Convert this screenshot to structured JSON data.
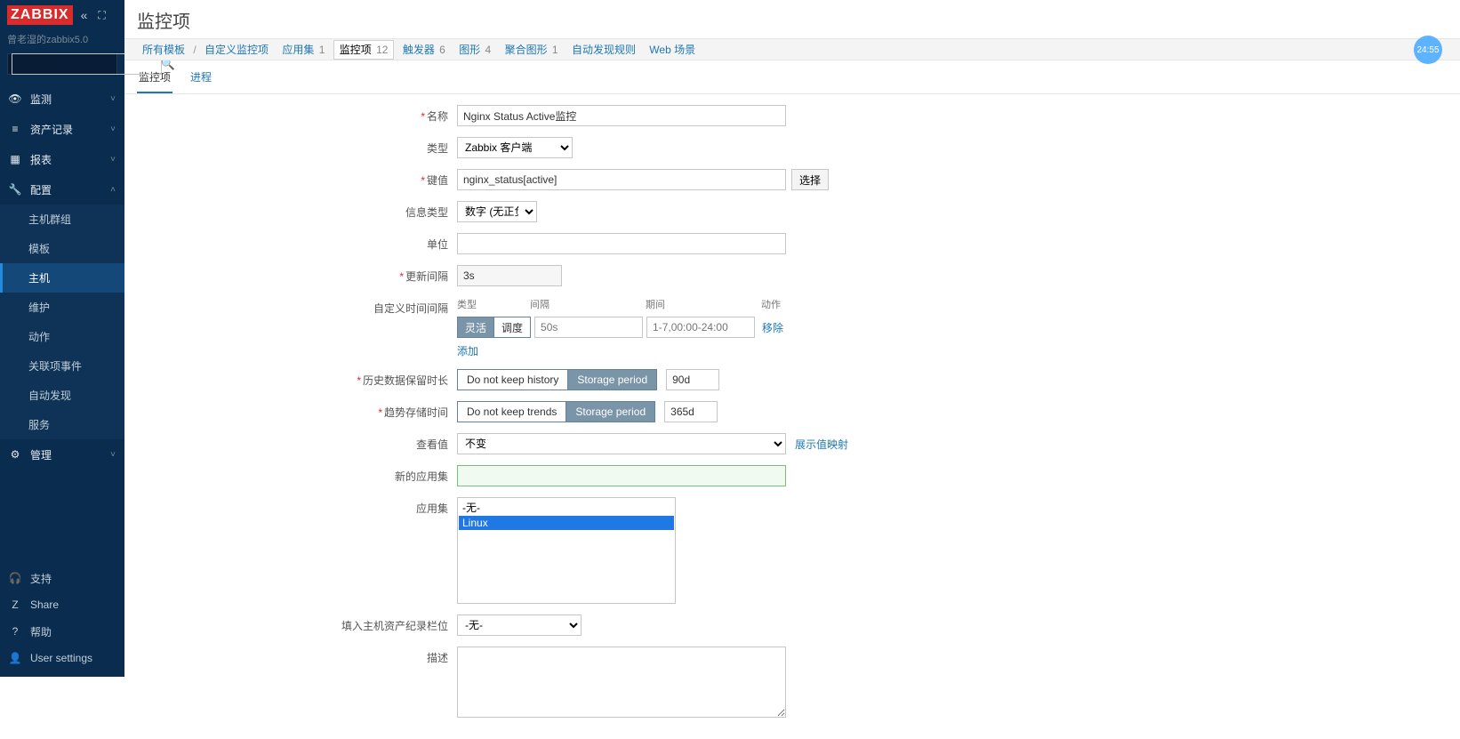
{
  "sidebar": {
    "logo": "ZABBIX",
    "subtitle": "曾老湿的zabbix5.0",
    "search_placeholder": "",
    "groups": [
      {
        "icon": "👁",
        "label": "监测",
        "open": false,
        "items": []
      },
      {
        "icon": "≡",
        "label": "资产记录",
        "open": false,
        "items": []
      },
      {
        "icon": "▦",
        "label": "报表",
        "open": false,
        "items": []
      },
      {
        "icon": "🔧",
        "label": "配置",
        "open": true,
        "items": [
          {
            "label": "主机群组",
            "active": false
          },
          {
            "label": "模板",
            "active": false
          },
          {
            "label": "主机",
            "active": true
          },
          {
            "label": "维护",
            "active": false
          },
          {
            "label": "动作",
            "active": false
          },
          {
            "label": "关联项事件",
            "active": false
          },
          {
            "label": "自动发现",
            "active": false
          },
          {
            "label": "服务",
            "active": false
          }
        ]
      },
      {
        "icon": "⚙",
        "label": "管理",
        "open": false,
        "items": []
      }
    ],
    "bottom": [
      {
        "icon": "🎧",
        "label": "支持"
      },
      {
        "icon": "Z",
        "label": "Share"
      },
      {
        "icon": "?",
        "label": "帮助"
      },
      {
        "icon": "👤",
        "label": "User settings"
      }
    ]
  },
  "page": {
    "title": "监控项",
    "clock": "24:55"
  },
  "crumbs": [
    {
      "label": "所有模板",
      "count": ""
    },
    {
      "label": "自定义监控项",
      "count": ""
    },
    {
      "label": "应用集",
      "count": "1"
    },
    {
      "label": "监控项",
      "count": "12",
      "active": true
    },
    {
      "label": "触发器",
      "count": "6"
    },
    {
      "label": "图形",
      "count": "4"
    },
    {
      "label": "聚合图形",
      "count": "1"
    },
    {
      "label": "自动发现规则",
      "count": ""
    },
    {
      "label": "Web 场景",
      "count": ""
    }
  ],
  "tabs": [
    {
      "label": "监控项",
      "active": true
    },
    {
      "label": "进程",
      "active": false
    }
  ],
  "form": {
    "name": {
      "label": "名称",
      "value": "Nginx Status Active监控"
    },
    "type": {
      "label": "类型",
      "value": "Zabbix 客户端"
    },
    "key": {
      "label": "键值",
      "value": "nginx_status[active]",
      "select_btn": "选择"
    },
    "info_type": {
      "label": "信息类型",
      "value": "数字 (无正负)"
    },
    "units": {
      "label": "单位",
      "value": ""
    },
    "update_interval": {
      "label": "更新间隔",
      "value": "3s"
    },
    "custom_intervals": {
      "label": "自定义时间间隔",
      "head": {
        "type": "类型",
        "interval": "间隔",
        "period": "期间",
        "action": "动作"
      },
      "flex": "灵活",
      "sched": "调度",
      "interval_ph": "50s",
      "period_ph": "1-7,00:00-24:00",
      "remove": "移除",
      "add": "添加"
    },
    "history": {
      "label": "历史数据保留时长",
      "no": "Do not keep history",
      "sp": "Storage period",
      "val": "90d"
    },
    "trends": {
      "label": "趋势存储时间",
      "no": "Do not keep trends",
      "sp": "Storage period",
      "val": "365d"
    },
    "valuemap": {
      "label": "查看值",
      "value": "不变",
      "link": "展示值映射"
    },
    "new_app": {
      "label": "新的应用集",
      "value": ""
    },
    "apps": {
      "label": "应用集",
      "none": "-无-",
      "linux": "Linux"
    },
    "inventory": {
      "label": "填入主机资产纪录栏位",
      "value": "-无-"
    },
    "description": {
      "label": "描述",
      "value": ""
    }
  }
}
